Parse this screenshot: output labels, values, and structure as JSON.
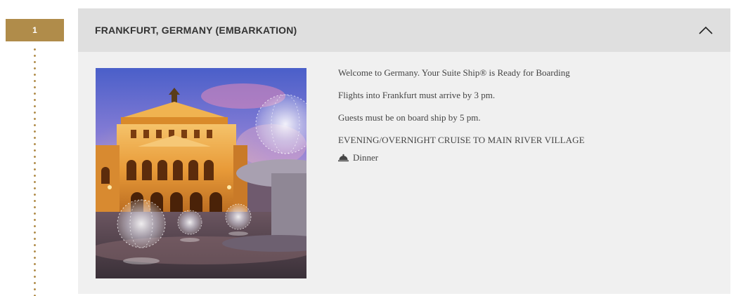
{
  "itinerary": {
    "day_number": "1",
    "location_title": "FRANKFURT, GERMANY (EMBARKATION)",
    "expanded": true,
    "details": {
      "welcome": "Welcome to Germany. Your Suite Ship® is Ready for Boarding",
      "flights_note": "Flights into Frankfurt must arrive by 3 pm.",
      "boarding_note": "Guests must be on board ship by 5 pm.",
      "cruise_note": "EVENING/OVERNIGHT CRUISE TO MAIN RIVER VILLAGE",
      "meals": [
        {
          "icon": "cloche-icon",
          "label": "Dinner"
        }
      ]
    },
    "photo": {
      "description_icon": "photo"
    }
  },
  "colors": {
    "accent_gold": "#b08c4a",
    "header_bg": "#dfdfdf",
    "panel_bg": "#f0f0f0",
    "title_text": "#333333",
    "body_text": "#444444"
  }
}
